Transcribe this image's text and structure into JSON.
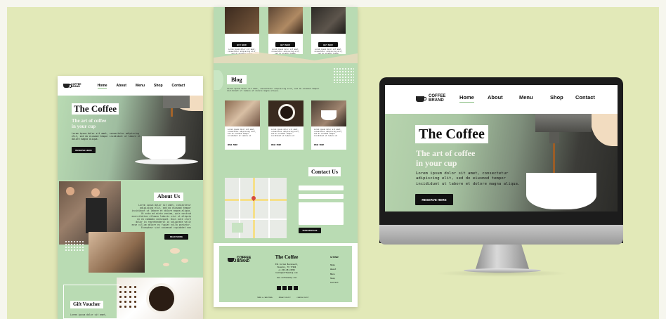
{
  "brand": {
    "line1": "COFFEE",
    "line2": "BRAND"
  },
  "nav": {
    "home": "Home",
    "about": "About",
    "menu": "Menu",
    "shop": "Shop",
    "contact": "Contact"
  },
  "hero": {
    "title": "The Coffee",
    "subtitle_line1": "The art of coffee",
    "subtitle_line2": "in your cup",
    "body": "Lorem ipsum dolor sit amet, consectetur adipiscing elit, sed do eiusmod tempor incididunt ut labore et dolore magna aliqua.",
    "button": "RESERVE HERE"
  },
  "about": {
    "title": "About Us",
    "body": "Lorem ipsum dolor sit amet, consectetur adipiscing elit, sed do eiusmod tempor incididunt ut labore et dolore magna aliqua. Ut enim ad minim veniam, quis nostrud exercitation ullamco laboris nisi ut aliquip ex ea commodo consequat. Duis aute irure dolor in reprehenderit in voluptate velit esse cillum dolore eu fugiat nulla pariatur. Excepteur sint occaecat cupidatat non proident, sunt in culpa qui officia deserunt mollit anim id est laborum. Sed ut perspiciatis unde omnis iste natus error sit voluptatem accusantium doloremque laudantium, totam rem aperiam, eaque ipsa quae ab illo inventore veritatis et quasi architecto beatae vitae dicta sunt explicabo. Nemo enim ipsam voluptatem quia voluptas sit aspernatur aut odit aut fugit, sed quia consequuntur magni dolores eos qui ratione voluptatem sequi nesciunt.",
    "button": "READ MORE"
  },
  "voucher": {
    "title": "Gift Voucher",
    "body": "Lorem ipsum dolor sit amet,"
  },
  "shop": {
    "button": "BUY NOW",
    "caption": "Lorem ipsum dolor sit amet, consectetur adipiscing elit, sed do eiusmod tempor incididunt ut labore et dolore magna aliqua. Ut enim ad minim veniam, quis nostrud exercitation ullamco laboris."
  },
  "blog": {
    "title": "Blog",
    "intro": "Lorem ipsum dolor sit amet, consectetur adipiscing elit, sed do eiusmod tempor incididunt ut labore et dolore magna aliqua.",
    "card_text": "Lorem ipsum dolor sit amet, consectetur adipiscing elit, sed do eiusmod tempor incididunt ut labore et dolore magna aliqua.",
    "read_more": "READ MORE"
  },
  "contact": {
    "title": "Contact Us",
    "send": "SEND MESSAGE"
  },
  "footer": {
    "title": "The Coffee",
    "addr1": "334 Cullen Boulevard,",
    "addr2": "Houston, TX 77204",
    "phone": "+1-342-261-8264",
    "email": "hello@coffeeshop.com",
    "site": "www.coffeeshop.com",
    "sitemap": "SITEMAP",
    "links": [
      "Home",
      "About",
      "Menu",
      "Shop",
      "Contact"
    ],
    "legal": [
      "TERMS & CONDITIONS",
      "PRIVACY POLICY",
      "COOKIES POLICY"
    ]
  },
  "colors": {
    "green": "#b9dbb3",
    "backdrop": "#e2e9b8",
    "dark": "#111111",
    "peach": "#f2dcc0"
  }
}
